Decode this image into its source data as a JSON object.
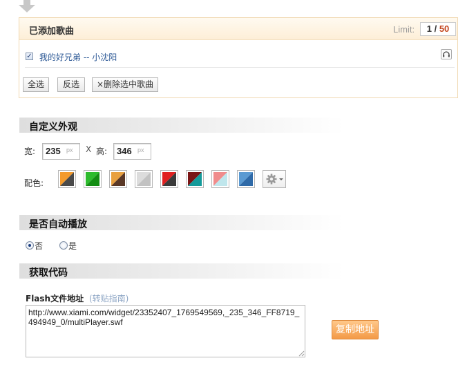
{
  "added_songs": {
    "title": "已添加歌曲",
    "limit_label": "Limit:",
    "limit_current": "1",
    "limit_separator": "/",
    "limit_max": "50",
    "songs": [
      {
        "title": "我的好兄弟 -- 小沈阳",
        "checked": true
      }
    ],
    "buttons": {
      "select_all": "全选",
      "invert": "反选",
      "delete_prefix": "×",
      "delete": "删除选中歌曲"
    }
  },
  "appearance": {
    "title": "自定义外观",
    "width_label": "宽:",
    "width_value": "235",
    "width_unit": "px",
    "times": "X",
    "height_label": "高:",
    "height_value": "346",
    "height_unit": "px",
    "color_label": "配色:",
    "color_schemes": [
      {
        "a": "#f39a2c",
        "b": "#4a4a4a"
      },
      {
        "a": "#2dbb2d",
        "b": "#138d13"
      },
      {
        "a": "#e8a03f",
        "b": "#5a3826"
      },
      {
        "a": "#dcdcdc",
        "b": "#c2c2c2"
      },
      {
        "a": "#e02020",
        "b": "#3a3a3a"
      },
      {
        "a": "#7a1414",
        "b": "#149a9a"
      },
      {
        "a": "#f08c8c",
        "b": "#bfe6ec"
      },
      {
        "a": "#5a9ad2",
        "b": "#2f6aa8"
      }
    ]
  },
  "autoplay": {
    "title": "是否自动播放",
    "options": [
      {
        "label": "否",
        "selected": true
      },
      {
        "label": "是",
        "selected": false
      }
    ]
  },
  "get_code": {
    "title": "获取代码",
    "flash_label": "Flash文件地址",
    "guide_link": "(转贴指南)",
    "code": "http://www.xiami.com/widget/23352407_1769549569,_235_346_FF8719_494949_0/multiPlayer.swf",
    "copy_button": "复制地址"
  },
  "colors": {
    "accent_orange": "#f39a47",
    "link_blue": "#2d5996",
    "limit_max_red": "#c4461e"
  }
}
